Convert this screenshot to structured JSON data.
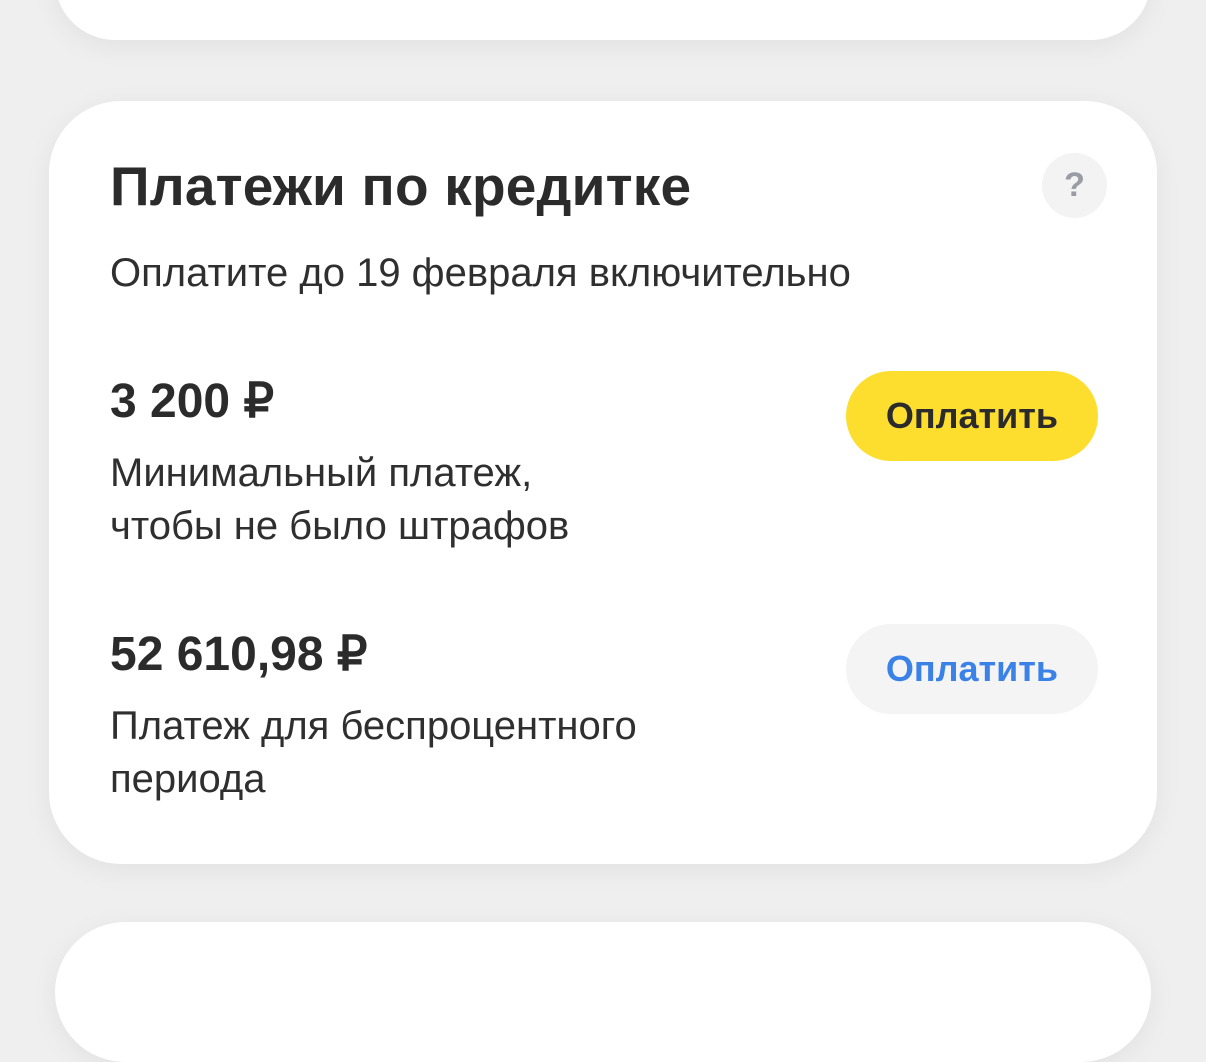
{
  "card": {
    "title": "Платежи по кредитке",
    "help_icon_glyph": "?",
    "subtitle": "Оплатите до 19 февраля включительно",
    "payments": [
      {
        "amount": "3 200 ₽",
        "description_line1": "Минимальный платеж,",
        "description_line2": "чтобы не было штрафов",
        "button_label": "Оплатить",
        "button_style": "primary"
      },
      {
        "amount": "52 610,98 ₽",
        "description_line1": "Платеж для беспроцентного",
        "description_line2": "периода",
        "button_label": "Оплатить",
        "button_style": "secondary"
      }
    ]
  },
  "colors": {
    "background": "#efefef",
    "card": "#ffffff",
    "primary_button": "#fddd2d",
    "secondary_button": "#f4f4f5",
    "secondary_button_text": "#3b82e8",
    "help_icon": "#9a9ba3"
  }
}
